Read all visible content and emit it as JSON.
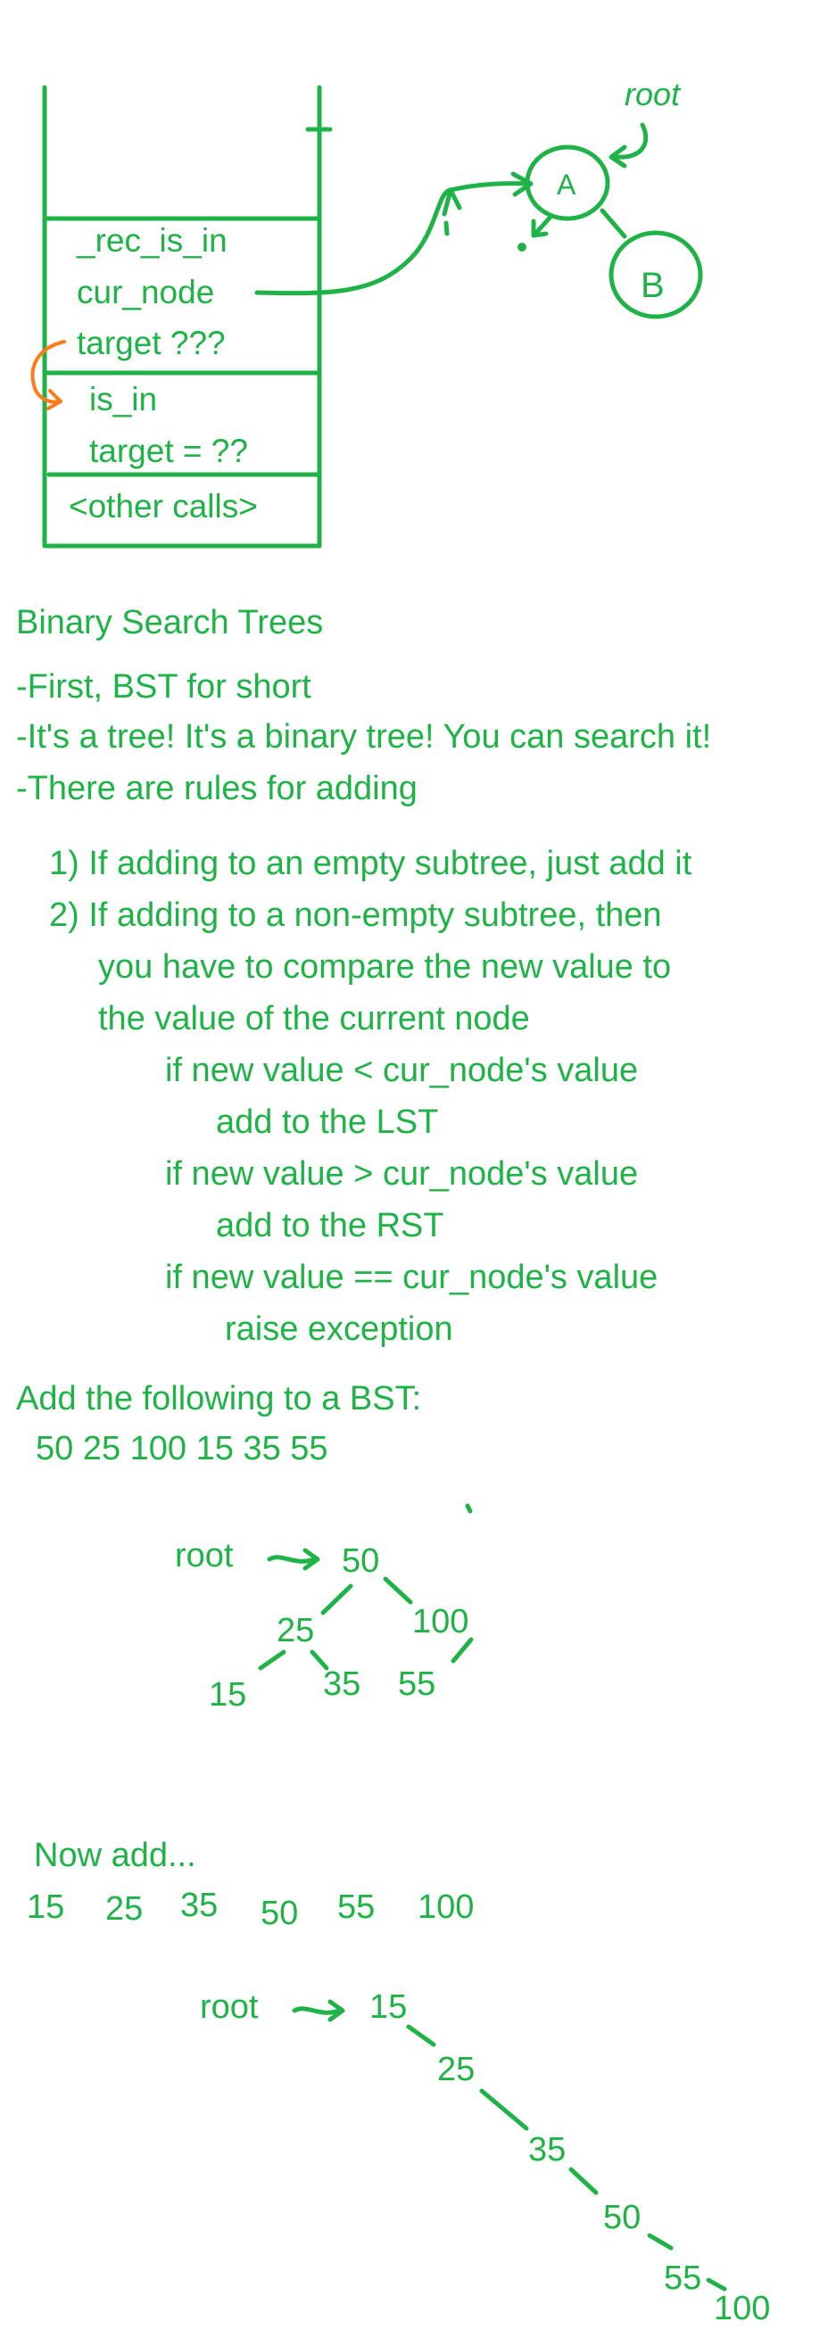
{
  "stack": {
    "frames": [
      "_rec_is_in",
      "cur_node",
      "target  ???",
      "is_in",
      "target = ??",
      "<other calls>"
    ]
  },
  "tree_sketch": {
    "root_label": "root",
    "node_a": "A",
    "node_b": "B"
  },
  "heading": "Binary Search Trees",
  "bullets": [
    "-First, BST for short",
    "-It's a tree! It's a binary tree! You can search it!",
    "-There are rules for adding"
  ],
  "rules": [
    "1) If adding to an empty subtree, just add it",
    "2) If adding to a non-empty subtree, then",
    "you have to compare the new value to",
    "the value of the current node",
    "if new value < cur_node's value",
    "add to the LST",
    "if new value > cur_node's value",
    "add to the RST",
    "if new value == cur_node's value",
    "raise exception"
  ],
  "example1": {
    "prompt": "Add the following to a BST:",
    "sequence": "50 25 100 15 35 55",
    "root_label": "root",
    "nodes": [
      "50",
      "25",
      "100",
      "15",
      "35",
      "55"
    ]
  },
  "example2": {
    "prompt": "Now add...",
    "sequence": [
      "15",
      "25",
      "35",
      "50",
      "55",
      "100"
    ],
    "root_label": "root",
    "nodes": [
      "15",
      "25",
      "35",
      "50",
      "55",
      "100"
    ]
  }
}
